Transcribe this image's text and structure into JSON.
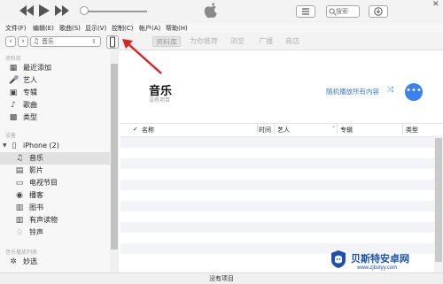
{
  "menu": [
    "文件(F)",
    "编辑(E)",
    "歌曲(S)",
    "显示(V)",
    "控制(C)",
    "帐户(A)",
    "帮助(H)"
  ],
  "nav": {
    "media_label": "音乐"
  },
  "tabs": [
    "资料库",
    "为你推荐",
    "浏览",
    "广播",
    "商店"
  ],
  "sidebar": {
    "library_header": "资料库",
    "library": [
      "最近添加",
      "艺人",
      "专辑",
      "歌曲",
      "类型"
    ],
    "devices_header": "设备",
    "device_name": "iPhone (2)",
    "device_items": [
      "音乐",
      "影片",
      "电视节目",
      "播客",
      "图书",
      "有声读物",
      "铃声"
    ],
    "playlists_header": "音乐播放列表",
    "playlist_first": "妙选"
  },
  "main": {
    "title": "音乐",
    "subtitle": "没有项目",
    "shuffle_label": "随机播放所有内容",
    "more_label": "•••"
  },
  "columns": {
    "check": "✓",
    "name": "名称",
    "time": "时间",
    "artist": "艺人",
    "album": "专辑",
    "genre": "类型"
  },
  "status": "没有项目",
  "watermark": {
    "title": "贝斯特安卓网",
    "url": "www.zjbstyy.com"
  },
  "colors": {
    "accent": "#3b82f0",
    "arrow": "#e02020"
  }
}
